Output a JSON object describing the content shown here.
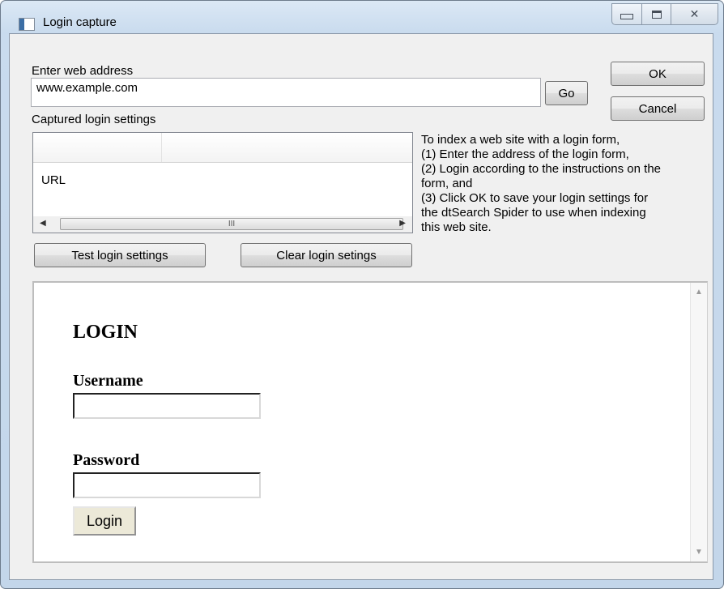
{
  "window": {
    "title": "Login capture",
    "minimize_glyph": "",
    "maximize_glyph": "",
    "close_glyph": "✕"
  },
  "address": {
    "label": "Enter web address",
    "value": "www.example.com",
    "go_label": "Go"
  },
  "dialog_buttons": {
    "ok_label": "OK",
    "cancel_label": "Cancel"
  },
  "captured": {
    "label": "Captured login settings",
    "rows": [
      "URL"
    ],
    "scroll_thumb_glyph": "III"
  },
  "actions": {
    "test_label": "Test login settings",
    "clear_label": "Clear login setings"
  },
  "instructions": {
    "lines": [
      "To index a web site with a login form,",
      "(1) Enter the address of the login form,",
      "(2) Login according to the instructions on the",
      "form, and",
      "(3) Click OK to save your login settings for",
      "the dtSearch Spider to use when indexing",
      "this web site."
    ]
  },
  "webpage": {
    "heading": "LOGIN",
    "username_label": "Username",
    "username_value": "",
    "password_label": "Password",
    "password_value": "",
    "login_button": "Login"
  }
}
